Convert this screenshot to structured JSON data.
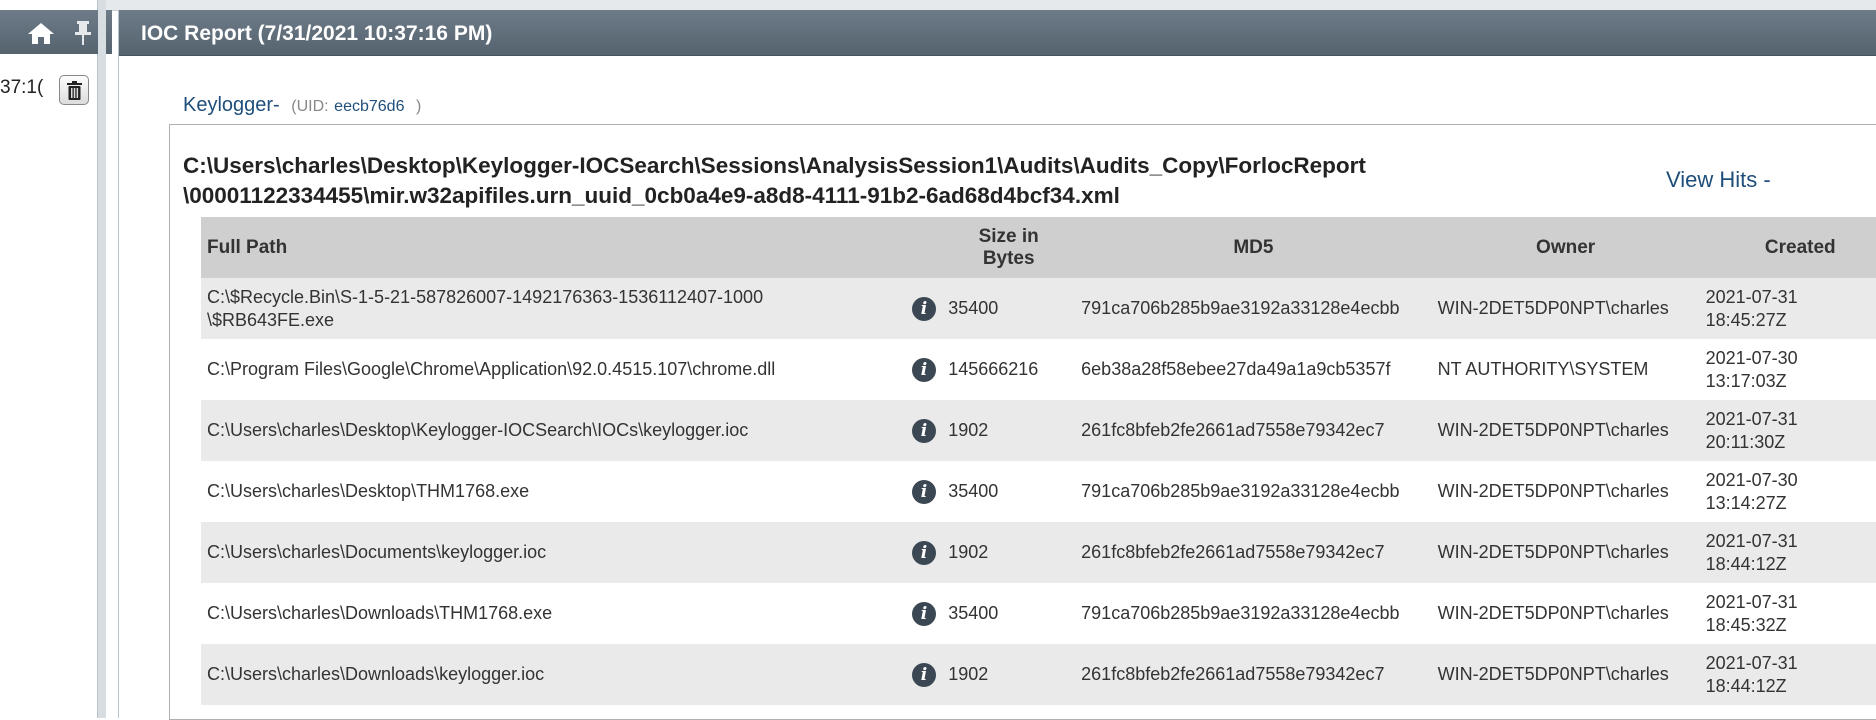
{
  "left_panel": {
    "time_fragment": "37:1(",
    "home_icon": "home-icon",
    "pin_icon": "pin-icon",
    "trash_icon": "trash-icon"
  },
  "report": {
    "title": "IOC Report (7/31/2021 10:37:16 PM)",
    "ioc_name": "Keylogger-",
    "uid_label": "(UID:",
    "uid_value": "eecb76d6",
    "uid_close": ")",
    "file_path_line1": "C:\\Users\\charles\\Desktop\\Keylogger-IOCSearch\\Sessions\\AnalysisSession1\\Audits\\Audits_Copy\\ForlocReport",
    "file_path_line2": "\\00001122334455\\mir.w32apifiles.urn_uuid_0cb0a4e9-a8d8-4111-91b2-6ad68d4bcf34.xml",
    "view_hits": "View Hits -"
  },
  "table": {
    "headers": {
      "full_path": "Full Path",
      "size_line1": "Size in",
      "size_line2": "Bytes",
      "md5": "MD5",
      "owner": "Owner",
      "created": "Created"
    },
    "rows": [
      {
        "path1": "C:\\$Recycle.Bin\\S-1-5-21-587826007-1492176363-1536112407-1000",
        "path2": "\\$RB643FE.exe",
        "size": "35400",
        "md5": "791ca706b285b9ae3192a33128e4ecbb",
        "owner": "WIN-2DET5DP0NPT\\charles",
        "created1": "2021-07-31",
        "created2": "18:45:27Z"
      },
      {
        "path1": "C:\\Program Files\\Google\\Chrome\\Application\\92.0.4515.107\\chrome.dll",
        "path2": "",
        "size": "145666216",
        "md5": "6eb38a28f58ebee27da49a1a9cb5357f",
        "owner": "NT AUTHORITY\\SYSTEM",
        "created1": "2021-07-30",
        "created2": "13:17:03Z"
      },
      {
        "path1": "C:\\Users\\charles\\Desktop\\Keylogger-IOCSearch\\IOCs\\keylogger.ioc",
        "path2": "",
        "size": "1902",
        "md5": "261fc8bfeb2fe2661ad7558e79342ec7",
        "owner": "WIN-2DET5DP0NPT\\charles",
        "created1": "2021-07-31",
        "created2": "20:11:30Z"
      },
      {
        "path1": "C:\\Users\\charles\\Desktop\\THM1768.exe",
        "path2": "",
        "size": "35400",
        "md5": "791ca706b285b9ae3192a33128e4ecbb",
        "owner": "WIN-2DET5DP0NPT\\charles",
        "created1": "2021-07-30",
        "created2": "13:14:27Z"
      },
      {
        "path1": "C:\\Users\\charles\\Documents\\keylogger.ioc",
        "path2": "",
        "size": "1902",
        "md5": "261fc8bfeb2fe2661ad7558e79342ec7",
        "owner": "WIN-2DET5DP0NPT\\charles",
        "created1": "2021-07-31",
        "created2": "18:44:12Z"
      },
      {
        "path1": "C:\\Users\\charles\\Downloads\\THM1768.exe",
        "path2": "",
        "size": "35400",
        "md5": "791ca706b285b9ae3192a33128e4ecbb",
        "owner": "WIN-2DET5DP0NPT\\charles",
        "created1": "2021-07-31",
        "created2": "18:45:32Z"
      },
      {
        "path1": "C:\\Users\\charles\\Downloads\\keylogger.ioc",
        "path2": "",
        "size": "1902",
        "md5": "261fc8bfeb2fe2661ad7558e79342ec7",
        "owner": "WIN-2DET5DP0NPT\\charles",
        "created1": "2021-07-31",
        "created2": "18:44:12Z"
      }
    ],
    "info_icon": "info-icon",
    "info_glyph": "i"
  },
  "colors": {
    "header_bar": "#5f6d7a",
    "link_blue": "#1f4e7a",
    "row_alt": "#eaeaea",
    "table_header": "#cfcfcf"
  }
}
